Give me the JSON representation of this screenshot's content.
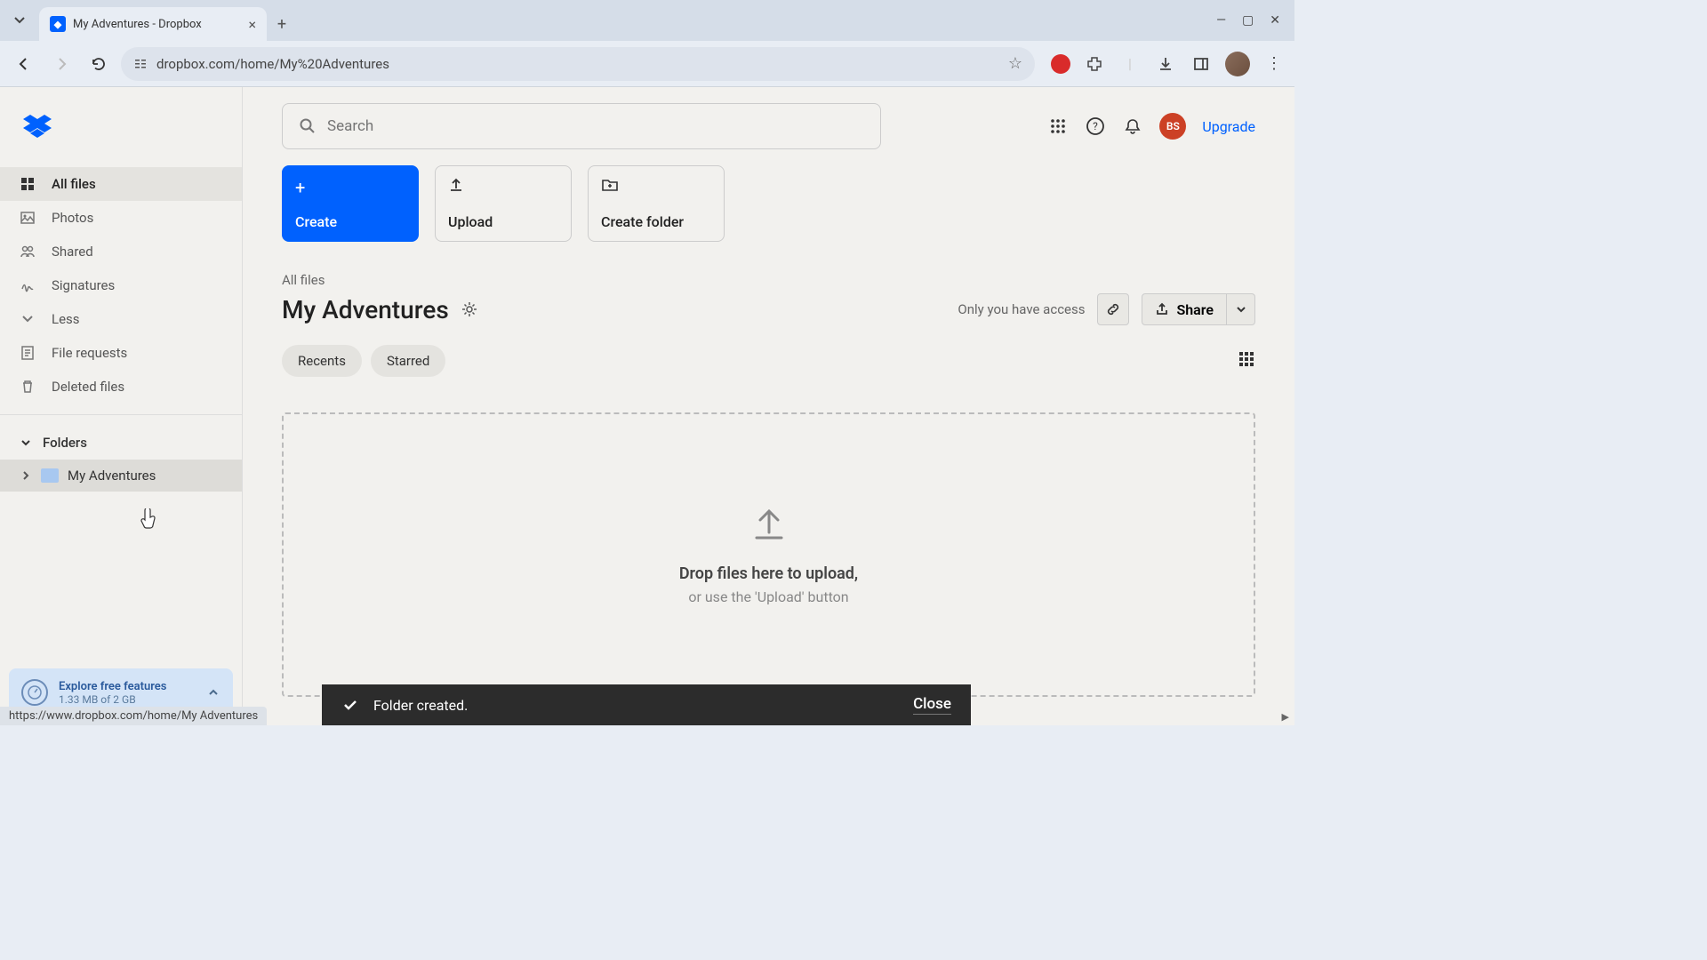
{
  "browser": {
    "tab_title": "My Adventures - Dropbox",
    "url": "dropbox.com/home/My%20Adventures",
    "status_bar": "https://www.dropbox.com/home/My Adventures"
  },
  "sidebar": {
    "items": [
      {
        "label": "All files"
      },
      {
        "label": "Photos"
      },
      {
        "label": "Shared"
      },
      {
        "label": "Signatures"
      },
      {
        "label": "Less"
      },
      {
        "label": "File requests"
      },
      {
        "label": "Deleted files"
      }
    ],
    "folders_header": "Folders",
    "folders": [
      {
        "label": "My Adventures"
      }
    ],
    "explore": {
      "title": "Explore free features",
      "sub": "1.33 MB of 2 GB"
    }
  },
  "header": {
    "search_placeholder": "Search",
    "avatar_initials": "BS",
    "upgrade": "Upgrade"
  },
  "actions": {
    "create": "Create",
    "upload": "Upload",
    "create_folder": "Create folder"
  },
  "breadcrumb": "All files",
  "folder_title": "My Adventures",
  "access_text": "Only you have access",
  "share_label": "Share",
  "filters": {
    "recents": "Recents",
    "starred": "Starred"
  },
  "dropzone": {
    "title": "Drop files here to upload,",
    "sub": "or use the 'Upload' button"
  },
  "toast": {
    "message": "Folder created.",
    "close": "Close"
  }
}
